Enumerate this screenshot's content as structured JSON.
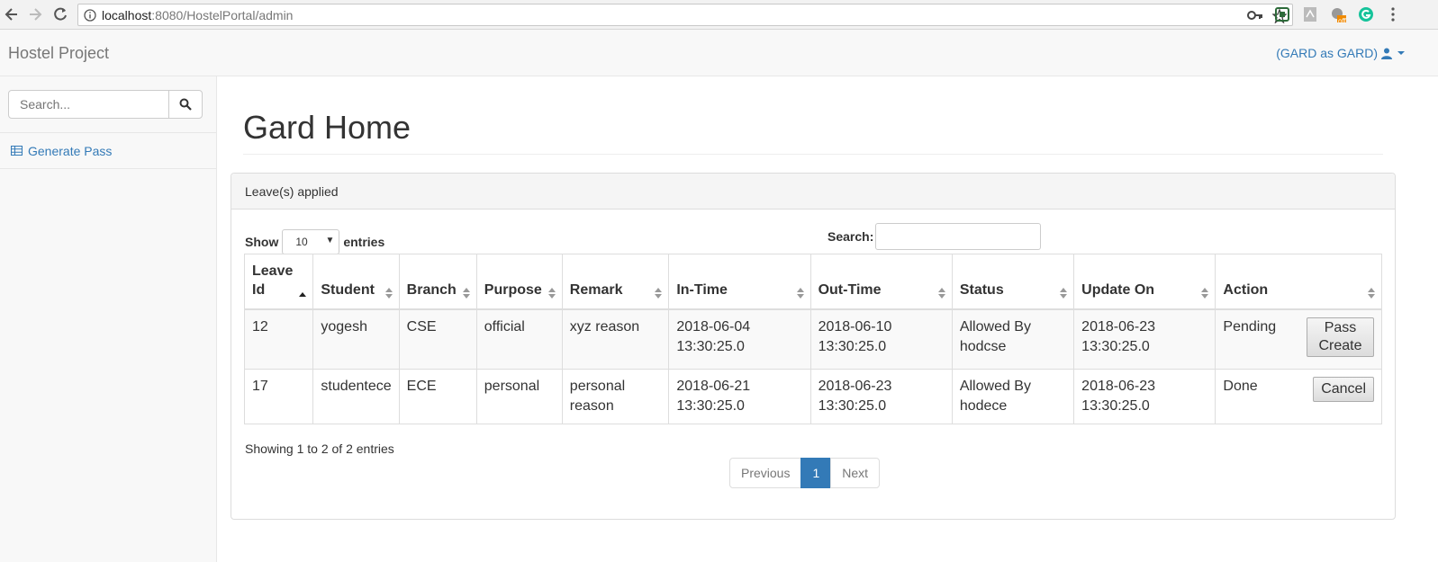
{
  "browser": {
    "url_host": "localhost",
    "url_path": ":8080/HostelPortal/admin",
    "ext_badge": "off"
  },
  "navbar": {
    "brand": "Hostel Project",
    "user": "(GARD as GARD)"
  },
  "sidebar": {
    "search_placeholder": "Search...",
    "items": [
      {
        "label": "Generate Pass",
        "icon": "table-icon"
      }
    ]
  },
  "main": {
    "title": "Gard Home",
    "panel_heading": "Leave(s) applied",
    "show_label": "Show",
    "show_value": "10",
    "entries_label": "entries",
    "search_label": "Search:",
    "columns": [
      "Leave Id",
      "Student",
      "Branch",
      "Purpose",
      "Remark",
      "In-Time",
      "Out-Time",
      "Status",
      "Update On",
      "Action"
    ],
    "rows": [
      {
        "id": "12",
        "student": "yogesh",
        "branch": "CSE",
        "purpose": "official",
        "remark": "xyz reason",
        "in_time": "2018-06-04 13:30:25.0",
        "out_time": "2018-06-10 13:30:25.0",
        "status": "Allowed By hodcse",
        "update_on": "2018-06-23 13:30:25.0",
        "action": "Pending",
        "button": "Pass Create"
      },
      {
        "id": "17",
        "student": "studentece",
        "branch": "ECE",
        "purpose": "personal",
        "remark": "personal reason",
        "in_time": "2018-06-21 13:30:25.0",
        "out_time": "2018-06-23 13:30:25.0",
        "status": "Allowed By hodece",
        "update_on": "2018-06-23 13:30:25.0",
        "action": "Done",
        "button": "Cancel"
      }
    ],
    "info": "Showing 1 to 2 of 2 entries",
    "pagination": {
      "previous": "Previous",
      "current": "1",
      "next": "Next"
    }
  },
  "colors": {
    "link": "#337ab7",
    "active_page": "#337ab7"
  }
}
